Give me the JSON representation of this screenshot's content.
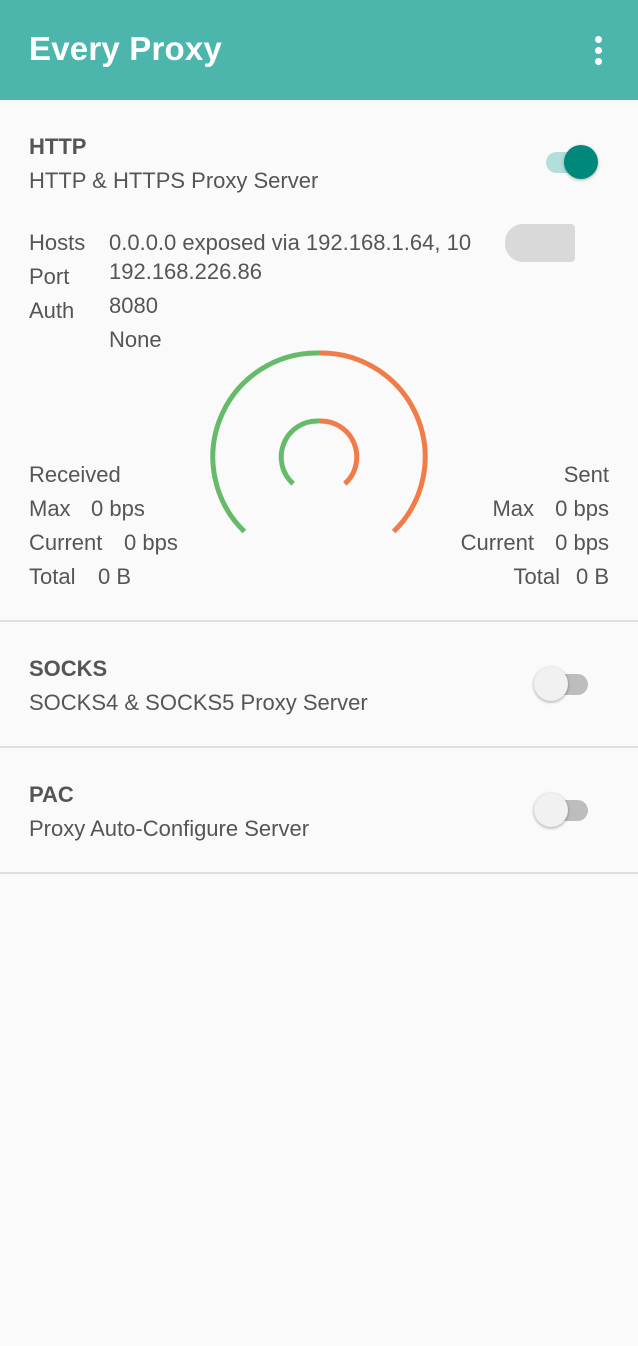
{
  "app": {
    "title": "Every Proxy"
  },
  "http": {
    "title": "HTTP",
    "subtitle": "HTTP & HTTPS Proxy Server",
    "enabled": true,
    "labels": {
      "hosts": "Hosts",
      "port": "Port",
      "auth": "Auth"
    },
    "hosts_line1": "0.0.0.0 exposed via 192.168.1.64, 10",
    "hosts_line2": "192.168.226.86",
    "port": "8080",
    "auth": "None",
    "received": {
      "heading": "Received",
      "max_label": "Max",
      "max": "0 bps",
      "current_label": "Current",
      "current": "0 bps",
      "total_label": "Total",
      "total": "0 B"
    },
    "sent": {
      "heading": "Sent",
      "max_label": "Max",
      "max": "0 bps",
      "current_label": "Current",
      "current": "0 bps",
      "total_label": "Total",
      "total": "0 B"
    },
    "gauge_colors": {
      "received": "#66bb6a",
      "sent": "#f07c4a"
    }
  },
  "socks": {
    "title": "SOCKS",
    "subtitle": "SOCKS4 & SOCKS5 Proxy Server",
    "enabled": false
  },
  "pac": {
    "title": "PAC",
    "subtitle": "Proxy Auto-Configure Server",
    "enabled": false
  },
  "colors": {
    "appbar": "#4db6ac",
    "switch_on": "#00897b"
  }
}
